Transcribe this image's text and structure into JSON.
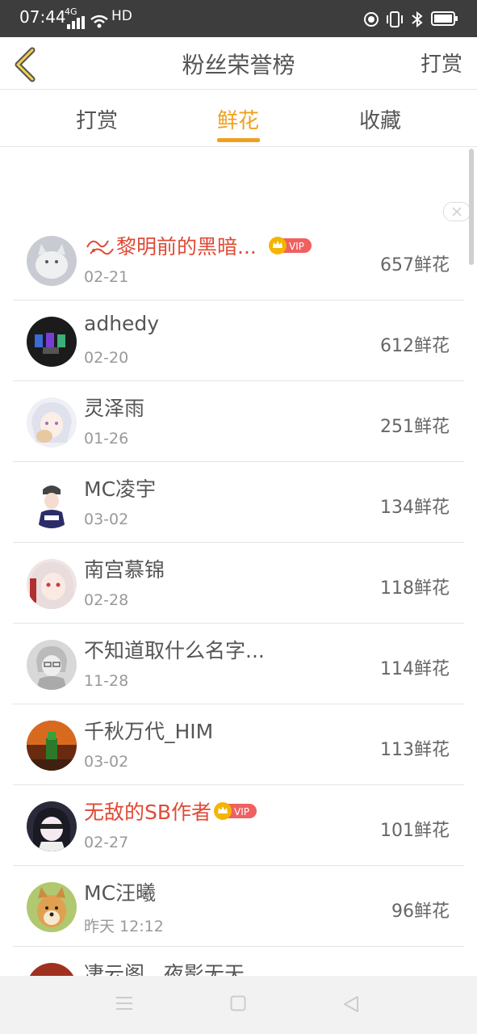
{
  "status_bar": {
    "time": "07:44",
    "network": "4G",
    "hd": "HD",
    "icons": [
      "signal-icon",
      "wifi-icon",
      "record-icon",
      "vibrate-icon",
      "bluetooth-icon",
      "battery-icon"
    ]
  },
  "header": {
    "back_icon": "chevron-left-icon",
    "title": "粉丝荣誉榜",
    "action": "打赏"
  },
  "tabs": [
    {
      "label": "打赏",
      "active": false
    },
    {
      "label": "鲜花",
      "active": true
    },
    {
      "label": "收藏",
      "active": false
    }
  ],
  "colors": {
    "accent": "#f0a020",
    "vip_name": "#e04a36",
    "status_bar": "#3d3d3d"
  },
  "fans": [
    {
      "name": "黎明前的黑暗...",
      "date": "02-21",
      "count": "657鲜花",
      "vip": "VIP",
      "highlight": true
    },
    {
      "name": "adhedy",
      "date": "02-20",
      "count": "612鲜花",
      "vip": "",
      "highlight": false
    },
    {
      "name": "灵泽雨",
      "date": "01-26",
      "count": "251鲜花",
      "vip": "",
      "highlight": false
    },
    {
      "name": "MC凌宇",
      "date": "03-02",
      "count": "134鲜花",
      "vip": "",
      "highlight": false
    },
    {
      "name": "南宫慕锦",
      "date": "02-28",
      "count": "118鲜花",
      "vip": "",
      "highlight": false
    },
    {
      "name": "不知道取什么名字...",
      "date": "11-28",
      "count": "114鲜花",
      "vip": "",
      "highlight": false
    },
    {
      "name": "千秋万代_HIM",
      "date": "03-02",
      "count": "113鲜花",
      "vip": "",
      "highlight": false
    },
    {
      "name": "无敌的SB作者",
      "date": "02-27",
      "count": "101鲜花",
      "vip": "VIP",
      "highlight": true
    },
    {
      "name": "MC汪曦",
      "date": "昨天 12:12",
      "count": "96鲜花",
      "vip": "",
      "highlight": false
    },
    {
      "name": "凄云阁...夜影无天",
      "date": "",
      "count": "",
      "vip": "",
      "highlight": false
    }
  ],
  "bottom_nav": {
    "icons": [
      "menu-icon",
      "home-square-icon",
      "back-triangle-icon"
    ]
  }
}
